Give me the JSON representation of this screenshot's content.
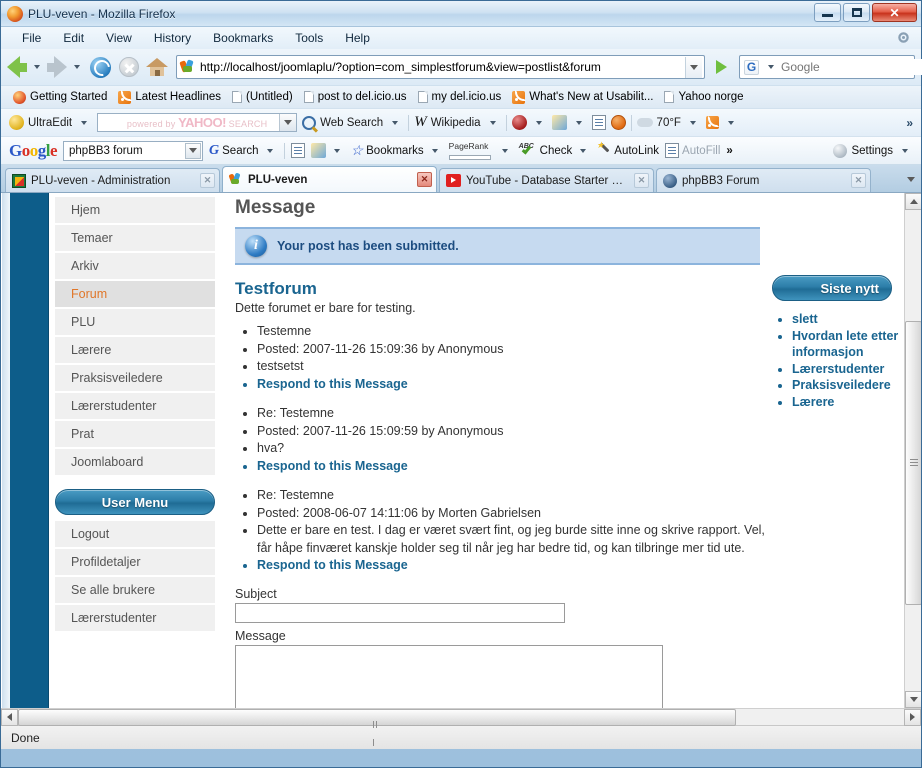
{
  "window": {
    "title": "PLU-veven - Mozilla Firefox",
    "controls": {
      "minimize": "Minimize",
      "maximize": "Maximize",
      "close": "Close"
    }
  },
  "menubar": {
    "items": [
      "File",
      "Edit",
      "View",
      "History",
      "Bookmarks",
      "Tools",
      "Help"
    ]
  },
  "navbar": {
    "back": "Back",
    "forward": "Forward",
    "reload": "Reload",
    "stop": "Stop",
    "home": "Home",
    "url": "http://localhost/joomlaplu/?option=com_simplestforum&view=postlist&forum",
    "go": "Go",
    "search_engine": "G",
    "search_placeholder": "Google"
  },
  "bookmarks": {
    "items": [
      {
        "label": "Getting Started",
        "icon": "firefox-icon"
      },
      {
        "label": "Latest Headlines",
        "icon": "rss-icon"
      },
      {
        "label": "(Untitled)",
        "icon": "page-icon"
      },
      {
        "label": "post to del.icio.us",
        "icon": "page-icon"
      },
      {
        "label": "my del.icio.us",
        "icon": "page-icon"
      },
      {
        "label": "What's New at Usabilit...",
        "icon": "rss-icon"
      },
      {
        "label": "Yahoo norge",
        "icon": "page-icon"
      }
    ]
  },
  "yahoo_toolbar": {
    "ultraedit": "UltraEdit",
    "search_ghost_pre": "powered by",
    "search_ghost_brand": "YAHOO!",
    "search_ghost_post": "SEARCH",
    "web_search": "Web Search",
    "wikipedia": "Wikipedia",
    "temperature": "70°F",
    "overflow": "»"
  },
  "google_toolbar": {
    "logo": {
      "g1": "G",
      "o1": "o",
      "o2": "o",
      "g2": "g",
      "l": "l",
      "e": "e"
    },
    "query": "phpBB3 forum",
    "search": "Search",
    "bookmarks": "Bookmarks",
    "pagerank": "PageRank",
    "check": "Check",
    "autolink": "AutoLink",
    "autofill": "AutoFill",
    "overflow": "»",
    "settings": "Settings"
  },
  "tabs": [
    {
      "label": "PLU-veven - Administration",
      "icon": "joomla-admin-icon",
      "active": false
    },
    {
      "label": "PLU-veven",
      "icon": "joomla-icon",
      "active": true
    },
    {
      "label": "YouTube - Database Starter Ki...",
      "icon": "youtube-icon",
      "active": false
    },
    {
      "label": "phpBB3 Forum",
      "icon": "phpbb-icon",
      "active": false
    }
  ],
  "sidebar": {
    "main_items": [
      {
        "label": "Hjem",
        "active": false
      },
      {
        "label": "Temaer",
        "active": false
      },
      {
        "label": "Arkiv",
        "active": false
      },
      {
        "label": "Forum",
        "active": true
      },
      {
        "label": "PLU",
        "active": false
      },
      {
        "label": "Lærere",
        "active": false
      },
      {
        "label": "Praksisveiledere",
        "active": false
      },
      {
        "label": "Lærerstudenter",
        "active": false
      },
      {
        "label": "Prat",
        "active": false
      },
      {
        "label": "Joomlaboard",
        "active": false
      }
    ],
    "user_menu_title": "User Menu",
    "user_items": [
      {
        "label": "Logout"
      },
      {
        "label": "Profildetaljer"
      },
      {
        "label": "Se alle brukere"
      },
      {
        "label": "Lærerstudenter"
      }
    ]
  },
  "main": {
    "heading": "Message",
    "alert": "Your post has been submitted.",
    "forum_title": "Testforum",
    "forum_desc": "Dette forumet er bare for testing.",
    "posts": [
      {
        "subject": "Testemne",
        "meta": "Posted: 2007-11-26 15:09:36 by Anonymous",
        "body": "testsetst",
        "respond": "Respond to this Message"
      },
      {
        "subject": "Re: Testemne",
        "meta": "Posted: 2007-11-26 15:09:59 by Anonymous",
        "body": "hva?",
        "respond": "Respond to this Message"
      },
      {
        "subject": "Re: Testemne",
        "meta": "Posted: 2008-06-07 14:11:06 by Morten Gabrielsen",
        "body": "Dette er bare en test. I dag er været svært fint, og jeg burde sitte inne og skrive rapport. Vel, får håpe finværet kanskje holder seg til når jeg har bedre tid, og kan tilbringe mer tid ute.",
        "respond": "Respond to this Message"
      }
    ],
    "form": {
      "subject_label": "Subject",
      "subject_value": "",
      "message_label": "Message",
      "message_value": ""
    }
  },
  "right_panel": {
    "title": "Siste nytt",
    "items": [
      {
        "label": "slett"
      },
      {
        "label": "Hvordan lete etter informasjon"
      },
      {
        "label": "Lærerstudenter"
      },
      {
        "label": "Praksisveiledere"
      },
      {
        "label": "Lærere"
      }
    ]
  },
  "statusbar": {
    "text": "Done"
  },
  "colors": {
    "accent_blue": "#1a6590",
    "active_link_orange": "#e0772a",
    "alert_bg": "#c6daf0",
    "left_band": "#0d5d8a",
    "pill_blue": "#2c7da8"
  }
}
